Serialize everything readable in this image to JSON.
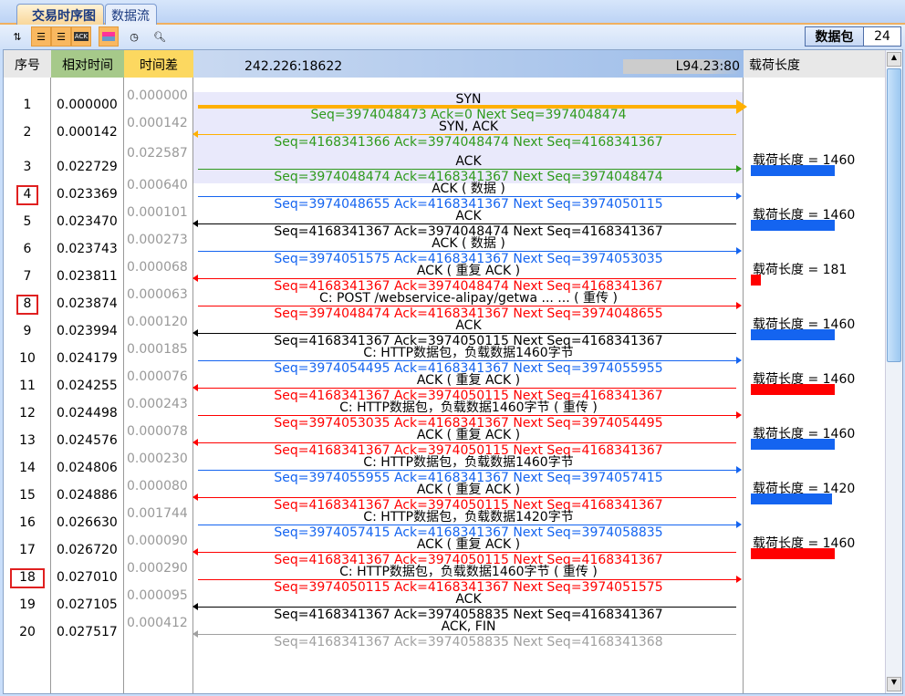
{
  "tabs": [
    {
      "label": "交易时序图",
      "active": true
    },
    {
      "label": "数据流",
      "active": false
    }
  ],
  "toolbar": {
    "icons": [
      "renumber-icon",
      "list-icon",
      "list-play-icon",
      "ack-icon",
      "color-bars-icon",
      "clock-icon",
      "search-icon"
    ],
    "packet_label": "数据包",
    "packet_count": "24"
  },
  "columns": {
    "seq": "序号",
    "rel_time": "相对时间",
    "delta": "时间差",
    "left_host": "242.226:18622",
    "right_host": "L94.23:80",
    "payload": "载荷长度"
  },
  "colors": {
    "orange": "#ffb000",
    "green": "#2f9a1c",
    "blue": "#1464f0",
    "black": "#000000",
    "red": "#ff0000",
    "gray": "#a0a0a0"
  },
  "rows": [
    {
      "no": "1",
      "rel": "0.000000",
      "delta": "0.000000",
      "dir": "right",
      "color": "orange",
      "seqcolor": "green",
      "label": "SYN",
      "seq": "Seq=3974048473  Ack=0  Next Seq=3974048474"
    },
    {
      "no": "2",
      "rel": "0.000142",
      "delta": "0.000142",
      "dir": "left",
      "color": "orange",
      "seqcolor": "green",
      "label": "SYN, ACK",
      "seq": "Seq=4168341366  Ack=3974048474  Next Seq=4168341367"
    },
    {
      "no": "3",
      "rel": "0.022729",
      "delta": "0.022587",
      "dir": "right",
      "color": "green",
      "seqcolor": "green",
      "label": "ACK",
      "seq": "Seq=3974048474  Ack=4168341367  Next Seq=3974048474"
    },
    {
      "no": "4",
      "rel": "0.023369",
      "delta": "0.000640",
      "dir": "right",
      "color": "blue",
      "seqcolor": "blue",
      "label": "ACK ( 数据 )",
      "seq": "Seq=3974048655  Ack=4168341367  Next Seq=3974050115",
      "marked": true,
      "payload": {
        "text": "载荷长度 = 1460",
        "value": 1460,
        "color": "blue"
      }
    },
    {
      "no": "5",
      "rel": "0.023470",
      "delta": "0.000101",
      "dir": "left",
      "color": "black",
      "seqcolor": "black",
      "label": "ACK",
      "seq": "Seq=4168341367  Ack=3974048474  Next Seq=4168341367"
    },
    {
      "no": "6",
      "rel": "0.023743",
      "delta": "0.000273",
      "dir": "right",
      "color": "blue",
      "seqcolor": "blue",
      "label": "ACK ( 数据 )",
      "seq": "Seq=3974051575  Ack=4168341367  Next Seq=3974053035",
      "payload": {
        "text": "载荷长度 = 1460",
        "value": 1460,
        "color": "blue"
      }
    },
    {
      "no": "7",
      "rel": "0.023811",
      "delta": "0.000068",
      "dir": "left",
      "color": "red",
      "seqcolor": "red",
      "label": "ACK ( 重复 ACK )",
      "seq": "Seq=4168341367  Ack=3974048474  Next Seq=4168341367"
    },
    {
      "no": "8",
      "rel": "0.023874",
      "delta": "0.000063",
      "dir": "right",
      "color": "red",
      "seqcolor": "red",
      "label": "C: POST /webservice-alipay/getwa ... ... ( 重传 )",
      "seq": "Seq=3974048474  Ack=4168341367  Next Seq=3974048655",
      "marked": true,
      "payload": {
        "text": "载荷长度 = 181",
        "value": 181,
        "color": "red"
      }
    },
    {
      "no": "9",
      "rel": "0.023994",
      "delta": "0.000120",
      "dir": "left",
      "color": "black",
      "seqcolor": "black",
      "label": "ACK",
      "seq": "Seq=4168341367  Ack=3974050115  Next Seq=4168341367"
    },
    {
      "no": "10",
      "rel": "0.024179",
      "delta": "0.000185",
      "dir": "right",
      "color": "blue",
      "seqcolor": "blue",
      "label": "C: HTTP数据包，负载数据1460字节",
      "seq": "Seq=3974054495  Ack=4168341367  Next Seq=3974055955",
      "payload": {
        "text": "载荷长度 = 1460",
        "value": 1460,
        "color": "blue"
      }
    },
    {
      "no": "11",
      "rel": "0.024255",
      "delta": "0.000076",
      "dir": "left",
      "color": "red",
      "seqcolor": "red",
      "label": "ACK ( 重复 ACK )",
      "seq": "Seq=4168341367  Ack=3974050115  Next Seq=4168341367"
    },
    {
      "no": "12",
      "rel": "0.024498",
      "delta": "0.000243",
      "dir": "right",
      "color": "red",
      "seqcolor": "red",
      "label": "C: HTTP数据包，负载数据1460字节 ( 重传 )",
      "seq": "Seq=3974053035  Ack=4168341367  Next Seq=3974054495",
      "payload": {
        "text": "载荷长度 = 1460",
        "value": 1460,
        "color": "red"
      }
    },
    {
      "no": "13",
      "rel": "0.024576",
      "delta": "0.000078",
      "dir": "left",
      "color": "red",
      "seqcolor": "red",
      "label": "ACK ( 重复 ACK )",
      "seq": "Seq=4168341367  Ack=3974050115  Next Seq=4168341367"
    },
    {
      "no": "14",
      "rel": "0.024806",
      "delta": "0.000230",
      "dir": "right",
      "color": "blue",
      "seqcolor": "blue",
      "label": "C: HTTP数据包，负载数据1460字节",
      "seq": "Seq=3974055955  Ack=4168341367  Next Seq=3974057415",
      "payload": {
        "text": "载荷长度 = 1460",
        "value": 1460,
        "color": "blue"
      }
    },
    {
      "no": "15",
      "rel": "0.024886",
      "delta": "0.000080",
      "dir": "left",
      "color": "red",
      "seqcolor": "red",
      "label": "ACK ( 重复 ACK )",
      "seq": "Seq=4168341367  Ack=3974050115  Next Seq=4168341367"
    },
    {
      "no": "16",
      "rel": "0.026630",
      "delta": "0.001744",
      "dir": "right",
      "color": "blue",
      "seqcolor": "blue",
      "label": "C: HTTP数据包，负载数据1420字节",
      "seq": "Seq=3974057415  Ack=4168341367  Next Seq=3974058835",
      "payload": {
        "text": "载荷长度 = 1420",
        "value": 1420,
        "color": "blue"
      }
    },
    {
      "no": "17",
      "rel": "0.026720",
      "delta": "0.000090",
      "dir": "left",
      "color": "red",
      "seqcolor": "red",
      "label": "ACK ( 重复 ACK )",
      "seq": "Seq=4168341367  Ack=3974050115  Next Seq=4168341367"
    },
    {
      "no": "18",
      "rel": "0.027010",
      "delta": "0.000290",
      "dir": "right",
      "color": "red",
      "seqcolor": "red",
      "label": "C: HTTP数据包，负载数据1460字节 ( 重传 )",
      "seq": "Seq=3974050115  Ack=4168341367  Next Seq=3974051575",
      "marked": true,
      "payload": {
        "text": "载荷长度 = 1460",
        "value": 1460,
        "color": "red"
      }
    },
    {
      "no": "19",
      "rel": "0.027105",
      "delta": "0.000095",
      "dir": "left",
      "color": "black",
      "seqcolor": "black",
      "label": "ACK",
      "seq": "Seq=4168341367  Ack=3974058835  Next Seq=4168341367"
    },
    {
      "no": "20",
      "rel": "0.027517",
      "delta": "0.000412",
      "dir": "left",
      "color": "gray",
      "seqcolor": "gray",
      "label": "ACK, FIN",
      "seq": "Seq=4168341367  Ack=3974058835  Next Seq=4168341368"
    }
  ]
}
